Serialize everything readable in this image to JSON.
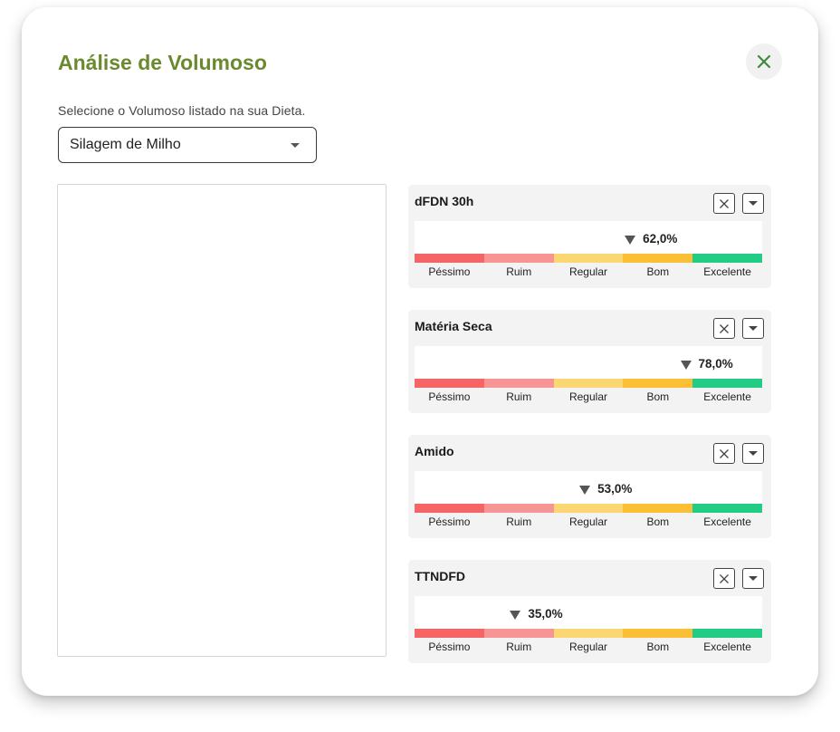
{
  "modal": {
    "title": "Análise de Volumoso",
    "close_icon": "close-icon"
  },
  "selector": {
    "label": "Selecione o Volumoso listado na sua Dieta.",
    "value": "Silagem de Milho"
  },
  "scale": {
    "labels": [
      "Péssimo",
      "Ruim",
      "Regular",
      "Bom",
      "Excelente"
    ],
    "colors": [
      "#f56565",
      "#f79494",
      "#fbd774",
      "#fbbf35",
      "#22cc84"
    ]
  },
  "metrics": [
    {
      "name": "dFDN 30h",
      "value": "62,0%",
      "position": 0.62
    },
    {
      "name": "Matéria Seca",
      "value": "78,0%",
      "position": 0.78
    },
    {
      "name": "Amido",
      "value": "53,0%",
      "position": 0.49
    },
    {
      "name": "TTNDFD",
      "value": "35,0%",
      "position": 0.29
    }
  ]
}
